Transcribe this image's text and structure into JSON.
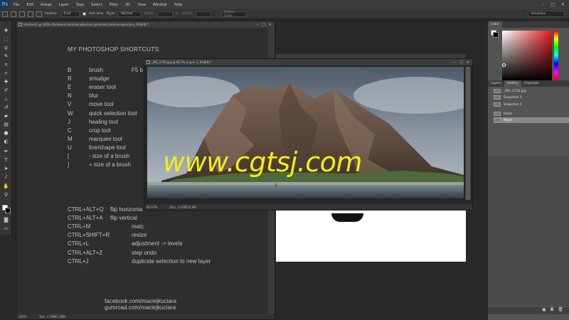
{
  "menubar": {
    "logo": "Ps",
    "items": [
      "File",
      "Edit",
      "Image",
      "Layer",
      "Type",
      "Select",
      "Filter",
      "3D",
      "View",
      "Window",
      "Help"
    ],
    "controls": [
      "–",
      "□",
      "✕"
    ]
  },
  "options": {
    "feather_label": "Feather:",
    "feather_value": "0 px",
    "antialias_label": "Anti-alias",
    "style_label": "Style:",
    "style_value": "Normal",
    "width_label": "Width:",
    "height_label": "Height:",
    "refine_label": "Refine Edge...",
    "workspace": "mkuciara"
  },
  "doc_shortcuts": {
    "tab_title": "Untitled-1 @ 100% (facebook.com/maciejkuciara gumroad.com/maciejkuciara, RGB/8) *",
    "zoom": "100%",
    "doc_info": "Doc: 1.78M/1.18M",
    "title": "MY PHOTOSHOP SHORTCUTS",
    "shortcuts": [
      {
        "key": "B",
        "desc": "brush",
        "extra": "F5   b"
      },
      {
        "key": "R",
        "desc": "smudge",
        "extra": ""
      },
      {
        "key": "E",
        "desc": "eraser tool",
        "extra": ""
      },
      {
        "key": "N",
        "desc": "blur",
        "extra": ""
      },
      {
        "key": "V",
        "desc": "move tool",
        "extra": ""
      },
      {
        "key": "W",
        "desc": "quick selection tool",
        "extra": ""
      },
      {
        "key": "J",
        "desc": "healing tool",
        "extra": ""
      },
      {
        "key": "C",
        "desc": "crop tool",
        "extra": ""
      },
      {
        "key": "M",
        "desc": "marquee tool",
        "extra": ""
      },
      {
        "key": "U",
        "desc": "line/shape tool",
        "extra": ""
      },
      {
        "key": "[",
        "desc": "- size of a brush",
        "extra": ""
      },
      {
        "key": "]",
        "desc": "+ size of a brush",
        "extra": ""
      }
    ],
    "ctrl_shortcuts": [
      {
        "key": "CTRL+ALT+Q",
        "desc": "flip horizonta"
      },
      {
        "key": "CTRL+ALT+A",
        "desc": "flip vertical"
      },
      {
        "key": "CTRL+M",
        "desc": "matc"
      },
      {
        "key": "CTRL+SHIFT+R",
        "desc": "resize"
      },
      {
        "key": "CTRL+L",
        "desc": "adjustment -> levels"
      },
      {
        "key": "CTRL+ALT+Z",
        "desc": "step undo"
      },
      {
        "key": "CTRL+J",
        "desc": "duplicate selection to new layer"
      }
    ],
    "links": [
      "facebook.com/maciejkuciara",
      "gumroad.com/maciejkuciara"
    ]
  },
  "doc_photo": {
    "tab_title": "_MG_3750.jpg @ 66.7% (Layer 1, RGB/8) *",
    "zoom": "66.67%",
    "doc_info": "Doc: 2.07M/10.9M",
    "watermark": "www.cgtsj.com"
  },
  "color_panel": {
    "tab": "Color"
  },
  "history_panel": {
    "tabs": [
      "Layers",
      "History",
      "Channels"
    ],
    "items": [
      {
        "label": "_MG_3750.jpg",
        "selected": false
      },
      {
        "label": "Snapshot 1",
        "selected": false
      },
      {
        "label": "Snapshot 2",
        "selected": false
      },
      {
        "label": "Paste",
        "selected": false
      },
      {
        "label": "Move",
        "selected": true
      }
    ]
  },
  "toolbar": {
    "tools": [
      "move-tool",
      "marquee-tool",
      "lasso-tool",
      "quick-selection-tool",
      "crop-tool",
      "eyedropper-tool",
      "healing-tool",
      "brush-tool",
      "clone-stamp-tool",
      "history-brush-tool",
      "eraser-tool",
      "gradient-tool",
      "blur-tool",
      "dodge-tool",
      "pen-tool",
      "type-tool",
      "path-selection-tool",
      "shape-tool",
      "hand-tool",
      "zoom-tool"
    ]
  },
  "colors": {
    "accent": "#f4ee15",
    "ps_blue": "#4fb3f3",
    "panel_bg": "#535353",
    "app_bg": "#282828"
  }
}
